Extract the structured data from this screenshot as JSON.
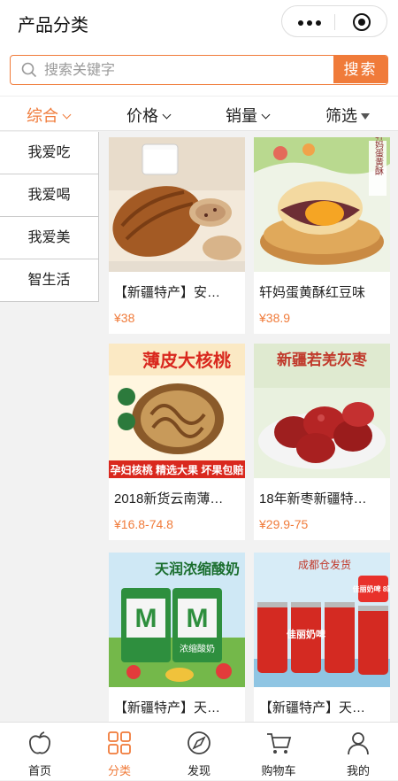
{
  "header": {
    "title": "产品分类"
  },
  "search": {
    "placeholder": "搜索关键字",
    "button": "搜索"
  },
  "filters": [
    {
      "label": "综合",
      "active": true,
      "icon": "chevron-down"
    },
    {
      "label": "价格",
      "active": false,
      "icon": "chevron-down"
    },
    {
      "label": "销量",
      "active": false,
      "icon": "chevron-down"
    },
    {
      "label": "筛选",
      "active": false,
      "icon": "funnel"
    }
  ],
  "sidebar": {
    "items": [
      {
        "label": "我爱吃"
      },
      {
        "label": "我爱喝"
      },
      {
        "label": "我爱美"
      },
      {
        "label": "智生活"
      }
    ]
  },
  "products": [
    {
      "name": "【新疆特产】安…",
      "price": "¥38"
    },
    {
      "name": "轩妈蛋黄酥红豆味",
      "price": "¥38.9",
      "image_text": [
        "轩妈蛋黄酥"
      ]
    },
    {
      "name": "2018新货云南薄…",
      "price": "¥16.8-74.8",
      "image_text": [
        "薄皮大核桃",
        "孕妇核桃 精选大果 坏果包赔"
      ]
    },
    {
      "name": "18年新枣新疆特…",
      "price": "¥29.9-75",
      "image_text": [
        "新疆若羌灰枣"
      ]
    },
    {
      "name": "【新疆特产】天…",
      "price": "",
      "image_text": [
        "天润浓缩酸奶",
        "浓缩酸奶"
      ]
    },
    {
      "name": "【新疆特产】天…",
      "price": "",
      "image_text": [
        "成都仓发货",
        "佳丽奶啤 8罐",
        "佳丽奶啤"
      ]
    }
  ],
  "tabbar": [
    {
      "label": "首页",
      "icon": "apple-icon",
      "active": false
    },
    {
      "label": "分类",
      "icon": "grid-icon",
      "active": true
    },
    {
      "label": "发现",
      "icon": "compass-icon",
      "active": false
    },
    {
      "label": "购物车",
      "icon": "cart-icon",
      "active": false
    },
    {
      "label": "我的",
      "icon": "user-icon",
      "active": false
    }
  ],
  "colors": {
    "accent": "#f07b3a",
    "price": "#f07b3a"
  }
}
